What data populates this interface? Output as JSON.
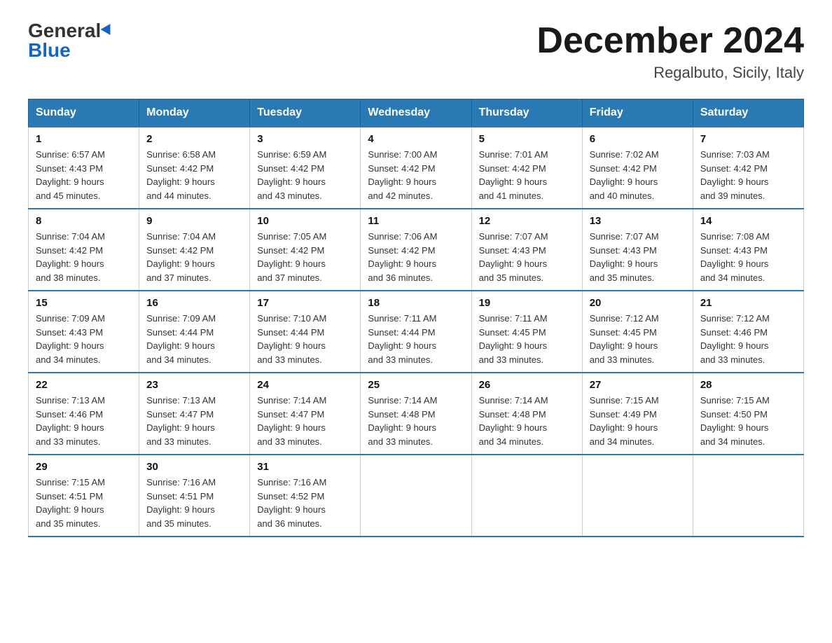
{
  "header": {
    "logo_general": "General",
    "logo_blue": "Blue",
    "month_title": "December 2024",
    "location": "Regalbuto, Sicily, Italy"
  },
  "weekdays": [
    "Sunday",
    "Monday",
    "Tuesday",
    "Wednesday",
    "Thursday",
    "Friday",
    "Saturday"
  ],
  "weeks": [
    [
      {
        "day": "1",
        "sunrise": "6:57 AM",
        "sunset": "4:43 PM",
        "daylight": "9 hours and 45 minutes."
      },
      {
        "day": "2",
        "sunrise": "6:58 AM",
        "sunset": "4:42 PM",
        "daylight": "9 hours and 44 minutes."
      },
      {
        "day": "3",
        "sunrise": "6:59 AM",
        "sunset": "4:42 PM",
        "daylight": "9 hours and 43 minutes."
      },
      {
        "day": "4",
        "sunrise": "7:00 AM",
        "sunset": "4:42 PM",
        "daylight": "9 hours and 42 minutes."
      },
      {
        "day": "5",
        "sunrise": "7:01 AM",
        "sunset": "4:42 PM",
        "daylight": "9 hours and 41 minutes."
      },
      {
        "day": "6",
        "sunrise": "7:02 AM",
        "sunset": "4:42 PM",
        "daylight": "9 hours and 40 minutes."
      },
      {
        "day": "7",
        "sunrise": "7:03 AM",
        "sunset": "4:42 PM",
        "daylight": "9 hours and 39 minutes."
      }
    ],
    [
      {
        "day": "8",
        "sunrise": "7:04 AM",
        "sunset": "4:42 PM",
        "daylight": "9 hours and 38 minutes."
      },
      {
        "day": "9",
        "sunrise": "7:04 AM",
        "sunset": "4:42 PM",
        "daylight": "9 hours and 37 minutes."
      },
      {
        "day": "10",
        "sunrise": "7:05 AM",
        "sunset": "4:42 PM",
        "daylight": "9 hours and 37 minutes."
      },
      {
        "day": "11",
        "sunrise": "7:06 AM",
        "sunset": "4:42 PM",
        "daylight": "9 hours and 36 minutes."
      },
      {
        "day": "12",
        "sunrise": "7:07 AM",
        "sunset": "4:43 PM",
        "daylight": "9 hours and 35 minutes."
      },
      {
        "day": "13",
        "sunrise": "7:07 AM",
        "sunset": "4:43 PM",
        "daylight": "9 hours and 35 minutes."
      },
      {
        "day": "14",
        "sunrise": "7:08 AM",
        "sunset": "4:43 PM",
        "daylight": "9 hours and 34 minutes."
      }
    ],
    [
      {
        "day": "15",
        "sunrise": "7:09 AM",
        "sunset": "4:43 PM",
        "daylight": "9 hours and 34 minutes."
      },
      {
        "day": "16",
        "sunrise": "7:09 AM",
        "sunset": "4:44 PM",
        "daylight": "9 hours and 34 minutes."
      },
      {
        "day": "17",
        "sunrise": "7:10 AM",
        "sunset": "4:44 PM",
        "daylight": "9 hours and 33 minutes."
      },
      {
        "day": "18",
        "sunrise": "7:11 AM",
        "sunset": "4:44 PM",
        "daylight": "9 hours and 33 minutes."
      },
      {
        "day": "19",
        "sunrise": "7:11 AM",
        "sunset": "4:45 PM",
        "daylight": "9 hours and 33 minutes."
      },
      {
        "day": "20",
        "sunrise": "7:12 AM",
        "sunset": "4:45 PM",
        "daylight": "9 hours and 33 minutes."
      },
      {
        "day": "21",
        "sunrise": "7:12 AM",
        "sunset": "4:46 PM",
        "daylight": "9 hours and 33 minutes."
      }
    ],
    [
      {
        "day": "22",
        "sunrise": "7:13 AM",
        "sunset": "4:46 PM",
        "daylight": "9 hours and 33 minutes."
      },
      {
        "day": "23",
        "sunrise": "7:13 AM",
        "sunset": "4:47 PM",
        "daylight": "9 hours and 33 minutes."
      },
      {
        "day": "24",
        "sunrise": "7:14 AM",
        "sunset": "4:47 PM",
        "daylight": "9 hours and 33 minutes."
      },
      {
        "day": "25",
        "sunrise": "7:14 AM",
        "sunset": "4:48 PM",
        "daylight": "9 hours and 33 minutes."
      },
      {
        "day": "26",
        "sunrise": "7:14 AM",
        "sunset": "4:48 PM",
        "daylight": "9 hours and 34 minutes."
      },
      {
        "day": "27",
        "sunrise": "7:15 AM",
        "sunset": "4:49 PM",
        "daylight": "9 hours and 34 minutes."
      },
      {
        "day": "28",
        "sunrise": "7:15 AM",
        "sunset": "4:50 PM",
        "daylight": "9 hours and 34 minutes."
      }
    ],
    [
      {
        "day": "29",
        "sunrise": "7:15 AM",
        "sunset": "4:51 PM",
        "daylight": "9 hours and 35 minutes."
      },
      {
        "day": "30",
        "sunrise": "7:16 AM",
        "sunset": "4:51 PM",
        "daylight": "9 hours and 35 minutes."
      },
      {
        "day": "31",
        "sunrise": "7:16 AM",
        "sunset": "4:52 PM",
        "daylight": "9 hours and 36 minutes."
      },
      null,
      null,
      null,
      null
    ]
  ],
  "labels": {
    "sunrise": "Sunrise:",
    "sunset": "Sunset:",
    "daylight": "Daylight:"
  }
}
